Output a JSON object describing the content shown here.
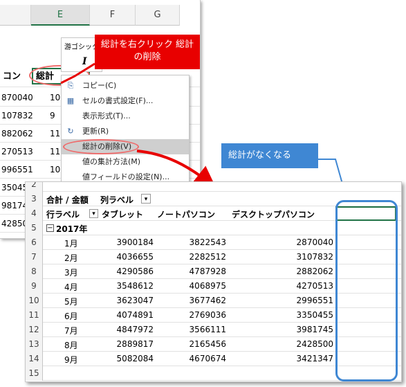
{
  "top_sheet": {
    "columns": [
      "E",
      "F",
      "G"
    ],
    "header_partial": "コン",
    "total_header": "総計",
    "rows": [
      {
        "d": "870040",
        "e": "10"
      },
      {
        "d": "107832",
        "e": "9"
      },
      {
        "d": "882062",
        "e": "11"
      },
      {
        "d": "270513",
        "e": "11"
      },
      {
        "d": "996551",
        "e": "10"
      },
      {
        "d": "35045",
        "e": ""
      },
      {
        "d": "98174",
        "e": ""
      },
      {
        "d": "42850",
        "e": ""
      }
    ]
  },
  "mini_toolbar": {
    "font": "游ゴシック",
    "italic": "I"
  },
  "context_menu": {
    "items": [
      {
        "label": "コピー(C)",
        "icon": "copy-icon"
      },
      {
        "label": "セルの書式設定(F)...",
        "icon": "format-cells-icon"
      },
      {
        "label": "表示形式(T)...",
        "icon": ""
      },
      {
        "label": "更新(R)",
        "icon": "refresh-icon"
      },
      {
        "label": "総計の削除(V)",
        "icon": ""
      },
      {
        "label": "値の集計方法(M)",
        "icon": ""
      },
      {
        "label": "値フィールドの設定(N)...",
        "icon": ""
      }
    ],
    "highlighted_index": 4
  },
  "callouts": {
    "red": "総計を右クリック 総計の削除",
    "blue": "総計がなくなる"
  },
  "pivot": {
    "row_numbers": [
      "2",
      "3",
      "4",
      "5",
      "6",
      "7",
      "8",
      "9",
      "10",
      "11",
      "12",
      "13",
      "14",
      "15"
    ],
    "summary_label": "合計 / 金額",
    "column_label": "列ラベル",
    "row_label": "行ラベル",
    "headers": [
      "タブレット",
      "ノートパソコン",
      "デスクトップパソコン"
    ],
    "year": "2017年",
    "collapse_symbol": "−",
    "filter_symbol": "▾",
    "rows": [
      {
        "month": "1月",
        "tablet": "3900184",
        "notebook": "3822543",
        "desktop": "2870040"
      },
      {
        "month": "2月",
        "tablet": "4036655",
        "notebook": "2282512",
        "desktop": "3107832"
      },
      {
        "month": "3月",
        "tablet": "4290586",
        "notebook": "4787928",
        "desktop": "2882062"
      },
      {
        "month": "4月",
        "tablet": "3548612",
        "notebook": "4068975",
        "desktop": "4270513"
      },
      {
        "month": "5月",
        "tablet": "3623047",
        "notebook": "3677462",
        "desktop": "2996551"
      },
      {
        "month": "6月",
        "tablet": "4074891",
        "notebook": "2769036",
        "desktop": "3350455"
      },
      {
        "month": "7月",
        "tablet": "4847972",
        "notebook": "3566111",
        "desktop": "3981745"
      },
      {
        "month": "8月",
        "tablet": "2889817",
        "notebook": "2165456",
        "desktop": "2428500"
      },
      {
        "month": "9月",
        "tablet": "5082084",
        "notebook": "4670674",
        "desktop": "3421347"
      }
    ]
  },
  "colors": {
    "red": "#e80000",
    "blue": "#3f87d3",
    "excel_green": "#217346"
  }
}
